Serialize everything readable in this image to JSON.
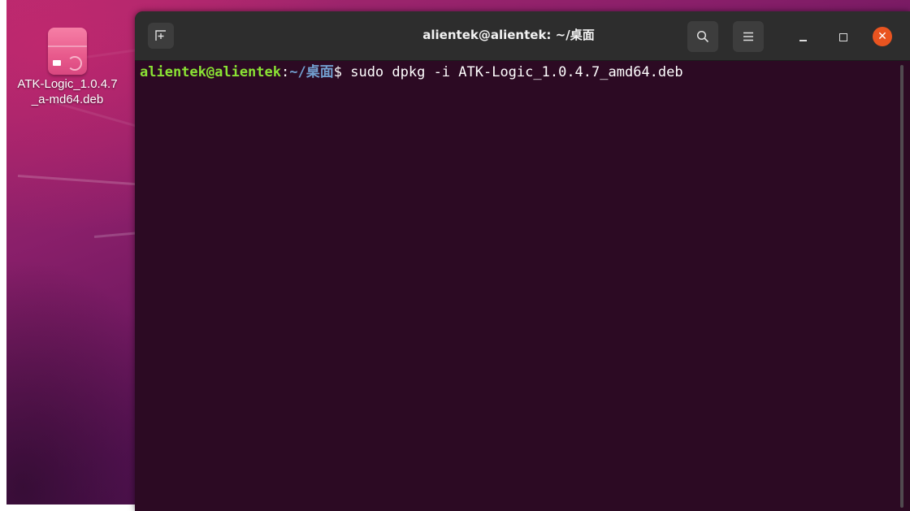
{
  "desktop": {
    "file": {
      "name": "ATK-Logic_1.0.4.7_a-md64.deb",
      "icon": "debian-package-icon"
    }
  },
  "terminal": {
    "title": "alientek@alientek: ~/桌面",
    "icons": {
      "new_tab": "new-tab-icon",
      "search": "search-icon",
      "menu": "hamburger-menu-icon",
      "minimize": "minimize-icon",
      "maximize": "maximize-icon",
      "close": "close-icon"
    },
    "lines": [
      {
        "user_host": "alientek@alientek",
        "separator": ":",
        "path": "~/桌面",
        "symbol": "$",
        "command": " sudo dpkg -i ATK-Logic_1.0.4.7_amd64.deb"
      }
    ]
  },
  "colors": {
    "terminal_bg": "#2c0a23",
    "titlebar_bg": "#2d2d2d",
    "prompt_user": "#8ae234",
    "prompt_path": "#729fcf",
    "close_button": "#e95420"
  }
}
